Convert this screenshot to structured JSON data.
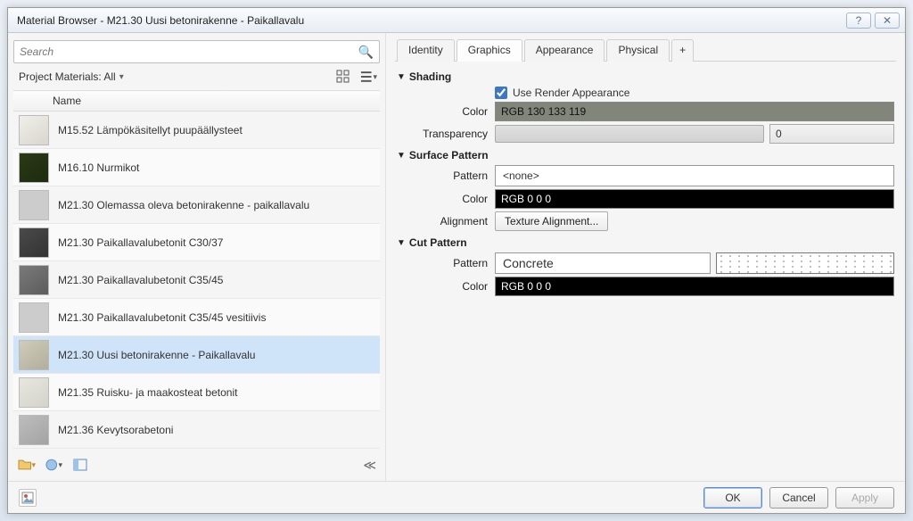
{
  "window": {
    "title": "Material Browser - M21.30 Uusi betonirakenne - Paikallavalu"
  },
  "search": {
    "placeholder": "Search"
  },
  "filter": {
    "label": "Project Materials: All"
  },
  "list": {
    "header": "Name",
    "items": [
      {
        "name": "M15.52 Lämpökäsitellyt puupäällysteet",
        "sw": "sw-light"
      },
      {
        "name": "M16.10 Nurmikot",
        "sw": "sw-grass"
      },
      {
        "name": "M21.30 Olemassa oleva betonirakenne - paikallavalu",
        "sw": "sw-noise1"
      },
      {
        "name": "M21.30 Paikallavalubetonit C30/37",
        "sw": "sw-dark"
      },
      {
        "name": "M21.30 Paikallavalubetonit C35/45",
        "sw": "sw-mid"
      },
      {
        "name": "M21.30 Paikallavalubetonit C35/45 vesitiivis",
        "sw": "sw-noise2"
      },
      {
        "name": "M21.30 Uusi betonirakenne - Paikallavalu",
        "sw": "sw-khaki",
        "selected": true
      },
      {
        "name": "M21.35 Ruisku- ja maakosteat betonit",
        "sw": "sw-pale"
      },
      {
        "name": "M21.36 Kevytsorabetoni",
        "sw": "sw-grey"
      }
    ]
  },
  "tabs": {
    "identity": "Identity",
    "graphics": "Graphics",
    "appearance": "Appearance",
    "physical": "Physical",
    "plus": "+"
  },
  "graphics": {
    "shading_title": "Shading",
    "use_render_label": "Use Render Appearance",
    "use_render_checked": true,
    "color_label": "Color",
    "color_value": "RGB 130 133 119",
    "transparency_label": "Transparency",
    "transparency_value": "0",
    "surface_title": "Surface Pattern",
    "surface_pattern_label": "Pattern",
    "surface_pattern_value": "<none>",
    "surface_color_label": "Color",
    "surface_color_value": "RGB 0 0 0",
    "alignment_label": "Alignment",
    "alignment_btn": "Texture Alignment...",
    "cut_title": "Cut Pattern",
    "cut_pattern_label": "Pattern",
    "cut_pattern_value": "Concrete",
    "cut_color_label": "Color",
    "cut_color_value": "RGB 0 0 0"
  },
  "buttons": {
    "ok": "OK",
    "cancel": "Cancel",
    "apply": "Apply"
  }
}
